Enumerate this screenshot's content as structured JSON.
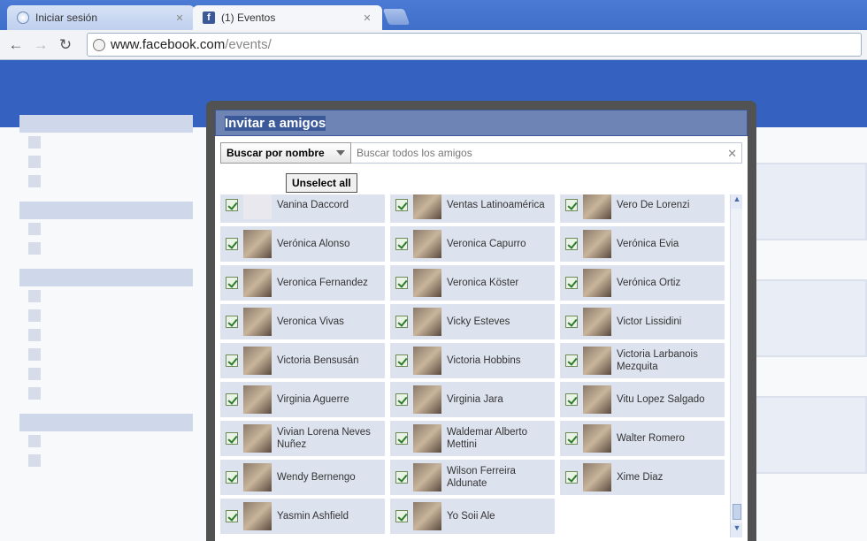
{
  "browser": {
    "tabs": [
      {
        "title": "Iniciar sesión",
        "icon": "globe-icon"
      },
      {
        "title": "(1) Eventos",
        "icon": "facebook-icon"
      }
    ],
    "url_host": "www.facebook.com",
    "url_path": "/events/"
  },
  "dialog": {
    "title": "Invitar a amigos",
    "filter_label": "Buscar por nombre",
    "search_placeholder": "Buscar todos los amigos",
    "unselect_label": "Unselect all"
  },
  "friends": [
    {
      "name": "Vanina Daccord",
      "selected": true
    },
    {
      "name": "Ventas Latinoamérica",
      "selected": true
    },
    {
      "name": "Vero De Lorenzi",
      "selected": true
    },
    {
      "name": "Verónica Alonso",
      "selected": true
    },
    {
      "name": "Veronica Capurro",
      "selected": true
    },
    {
      "name": "Verónica Evia",
      "selected": true
    },
    {
      "name": "Veronica Fernandez",
      "selected": true
    },
    {
      "name": "Veronica Köster",
      "selected": true
    },
    {
      "name": "Verónica Ortiz",
      "selected": true
    },
    {
      "name": "Veronica Vivas",
      "selected": true
    },
    {
      "name": "Vicky Esteves",
      "selected": true
    },
    {
      "name": "Victor Lissidini",
      "selected": true
    },
    {
      "name": "Victoria Bensusán",
      "selected": true
    },
    {
      "name": "Victoria Hobbins",
      "selected": true
    },
    {
      "name": "Victoria Larbanois Mezquita",
      "selected": true
    },
    {
      "name": "Virginia Aguerre",
      "selected": true
    },
    {
      "name": "Virginia Jara",
      "selected": true
    },
    {
      "name": "Vitu Lopez Salgado",
      "selected": true
    },
    {
      "name": "Vivian Lorena Neves Nuñez",
      "selected": true
    },
    {
      "name": "Waldemar Alberto Mettini",
      "selected": true
    },
    {
      "name": "Walter Romero",
      "selected": true
    },
    {
      "name": "Wendy Bernengo",
      "selected": true
    },
    {
      "name": "Wilson Ferreira Aldunate",
      "selected": true
    },
    {
      "name": "Xime Diaz",
      "selected": true
    },
    {
      "name": "Yasmin Ashfield",
      "selected": true
    },
    {
      "name": "Yo Soii Ale",
      "selected": true
    }
  ]
}
